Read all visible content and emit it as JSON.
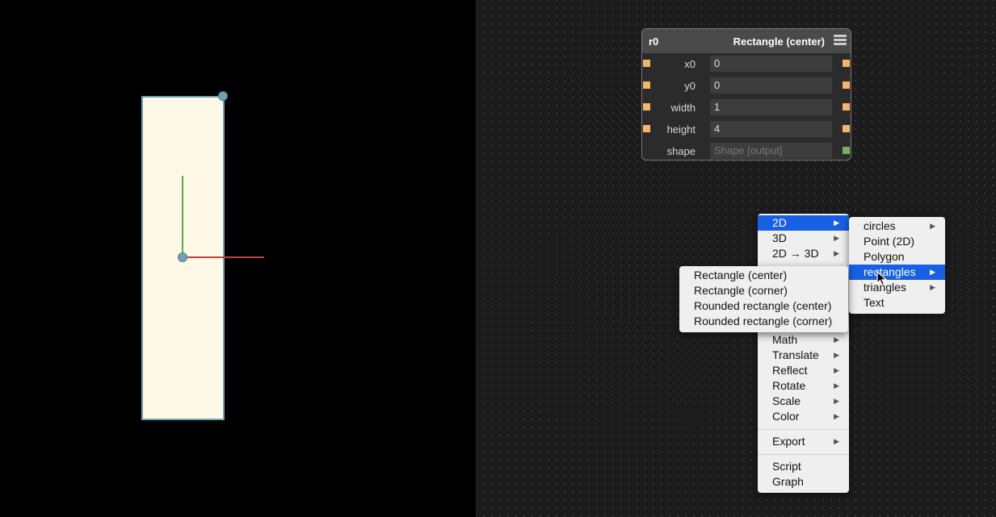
{
  "node": {
    "name": "r0",
    "title": "Rectangle (center)",
    "params": [
      {
        "label": "x0",
        "value": "0"
      },
      {
        "label": "y0",
        "value": "0"
      },
      {
        "label": "width",
        "value": "1"
      },
      {
        "label": "height",
        "value": "4"
      },
      {
        "label": "shape",
        "value": "Shape [output]"
      }
    ]
  },
  "main_menu": {
    "items": [
      "2D",
      "3D",
      "2D → 3D",
      "Math",
      "Translate",
      "Reflect",
      "Rotate",
      "Scale",
      "Color",
      "Export",
      "Script",
      "Graph"
    ],
    "selected": "2D"
  },
  "submenu_2d": {
    "items": [
      "circles",
      "Point (2D)",
      "Polygon",
      "rectangles",
      "triangles",
      "Text"
    ],
    "selected": "rectangles"
  },
  "submenu_rectangles": {
    "items": [
      "Rectangle (center)",
      "Rectangle (corner)",
      "Rounded rectangle (center)",
      "Rounded rectangle (corner)"
    ]
  },
  "icons": {
    "submenu_arrow": "triangle-right-icon",
    "node_menu": "hamburger-icon",
    "cursor": "arrow-cursor-icon"
  },
  "colors": {
    "shape_fill": "#fef8e6",
    "shape_stroke": "#6fa3b8",
    "axis_x": "#b6463f",
    "axis_y": "#5ca84a",
    "menu_highlight": "#1760e3",
    "input_port": "#f3b669",
    "output_port": "#77b25a"
  }
}
